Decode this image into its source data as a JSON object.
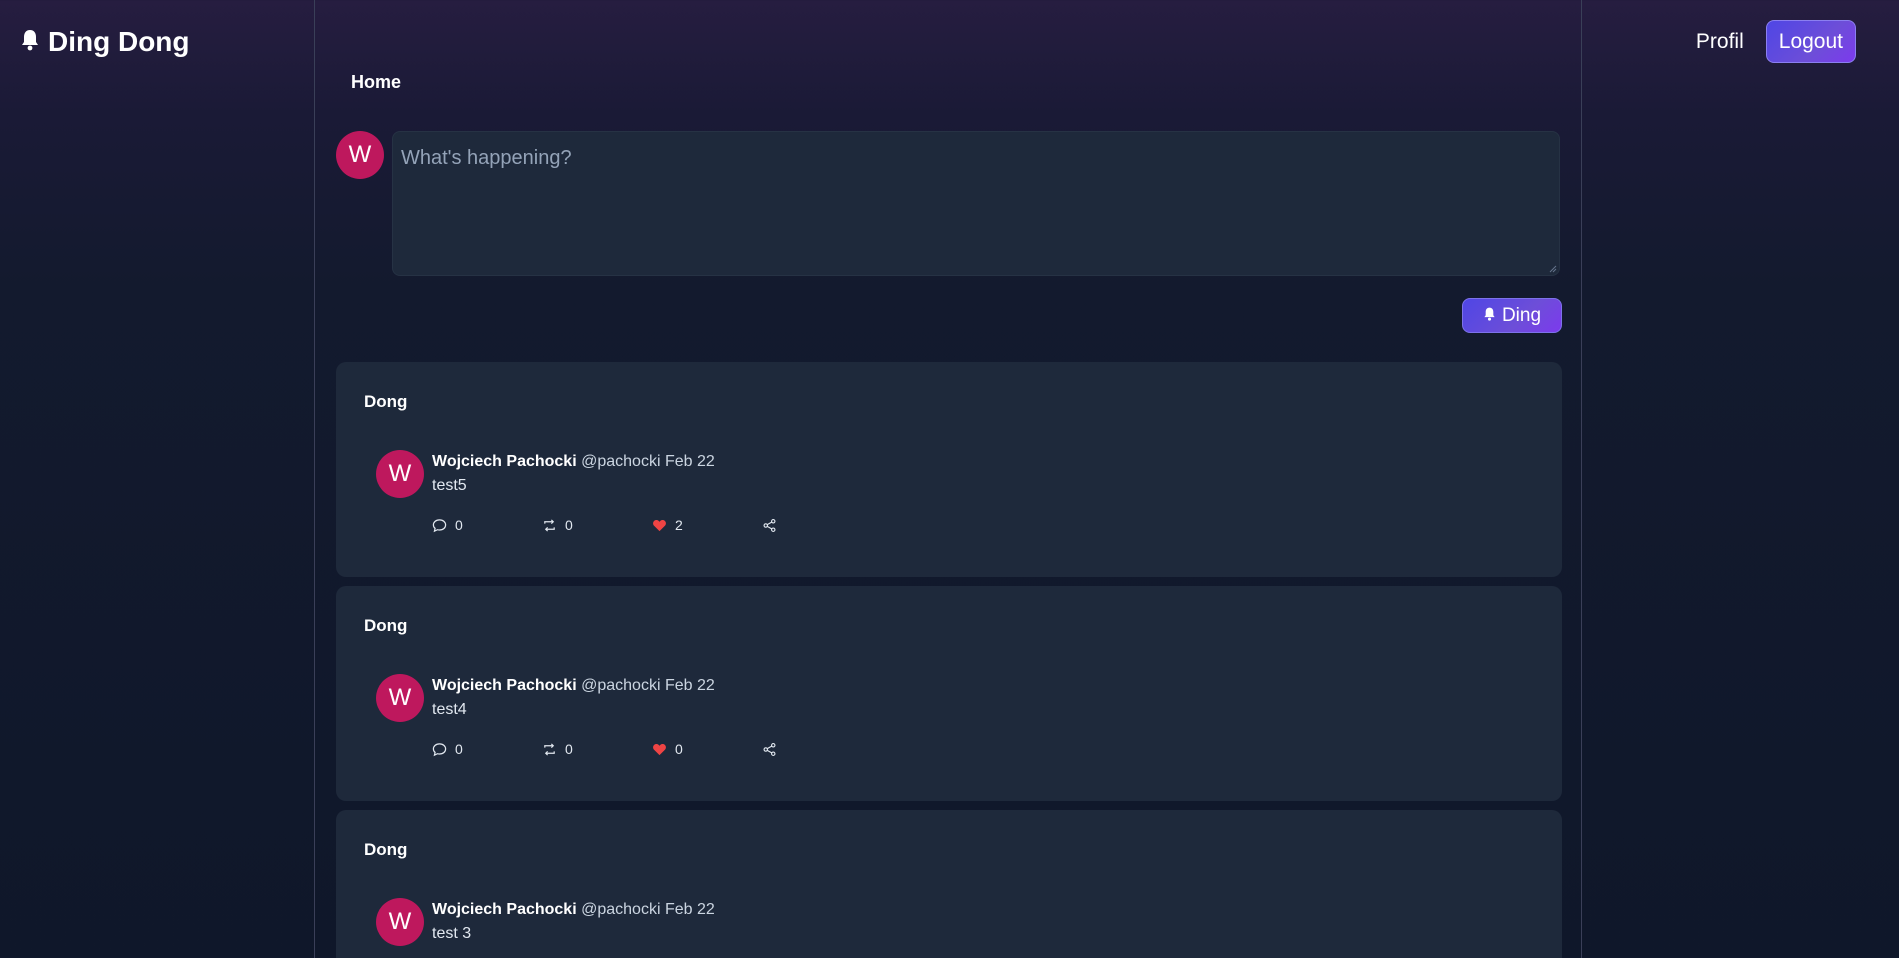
{
  "app": {
    "brand": "Ding Dong",
    "brand_icon": "bell-icon"
  },
  "header": {
    "profile_label": "Profil",
    "logout_label": "Logout"
  },
  "main": {
    "title": "Home",
    "compose": {
      "avatar_initial": "W",
      "placeholder": "What's happening?",
      "submit_label": "Ding",
      "submit_icon": "bell-icon"
    },
    "posts": [
      {
        "label": "Dong",
        "avatar_initial": "W",
        "author": "Wojciech Pachocki",
        "handle": "@pachocki",
        "date": "Feb 22",
        "text": "test5",
        "replies": "0",
        "reposts": "0",
        "likes": "2"
      },
      {
        "label": "Dong",
        "avatar_initial": "W",
        "author": "Wojciech Pachocki",
        "handle": "@pachocki",
        "date": "Feb 22",
        "text": "test4",
        "replies": "0",
        "reposts": "0",
        "likes": "0"
      },
      {
        "label": "Dong",
        "avatar_initial": "W",
        "author": "Wojciech Pachocki",
        "handle": "@pachocki",
        "date": "Feb 22",
        "text": "test 3"
      }
    ]
  },
  "colors": {
    "accent": "#5b4fe0",
    "avatar": "#be185d",
    "card": "#1e293b",
    "like": "#ef4444"
  }
}
